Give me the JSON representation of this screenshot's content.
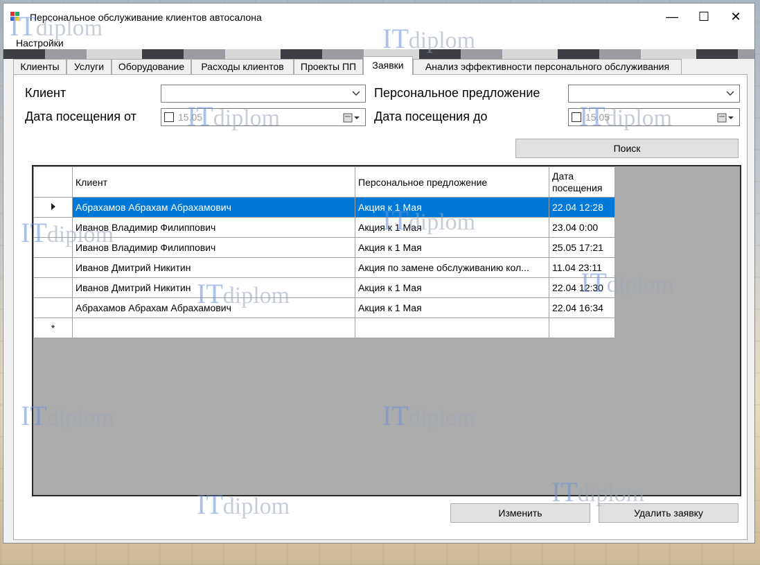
{
  "window": {
    "title": "Персональное обслуживание клиентов автосалона",
    "minimize_glyph": "—",
    "maximize_glyph": "☐",
    "close_glyph": "✕"
  },
  "menu": {
    "settings": "Настройки"
  },
  "tabs": [
    {
      "label": "Клиенты",
      "active": false
    },
    {
      "label": "Услуги",
      "active": false
    },
    {
      "label": "Оборудование",
      "active": false
    },
    {
      "label": "Расходы клиентов",
      "active": false
    },
    {
      "label": "Проекты ПП",
      "active": false
    },
    {
      "label": "Заявки",
      "active": true
    },
    {
      "label": "Анализ эффективности персонального обслуживания",
      "active": false
    }
  ],
  "filters": {
    "client_label": "Клиент",
    "client_value": "",
    "offer_label": "Персональное предложение",
    "offer_value": "",
    "date_from_label": "Дата посещения от",
    "date_from_value": "15.05",
    "date_to_label": "Дата посещения до",
    "date_to_value": "15.05",
    "search_button": "Поиск"
  },
  "grid": {
    "columns": [
      "Клиент",
      "Персональное предложение",
      "Дата\nпосещения"
    ],
    "rows": [
      {
        "client": "Абрахамов Абрахам Абрахамович",
        "offer": "Акция к 1 Мая",
        "date": "22.04 12:28",
        "selected": true
      },
      {
        "client": "Иванов Владимир Филиппович",
        "offer": "Акция к 1 Мая",
        "date": "23.04 0:00",
        "selected": false
      },
      {
        "client": "Иванов Владимир Филиппович",
        "offer": "Акция к 1 Мая",
        "date": "25.05 17:21",
        "selected": false
      },
      {
        "client": "Иванов Дмитрий Никитин",
        "offer": "Акция по замене обслуживанию кол...",
        "date": "11.04 23:11",
        "selected": false
      },
      {
        "client": "Иванов Дмитрий Никитин",
        "offer": "Акция к 1 Мая",
        "date": "22.04 12:30",
        "selected": false
      },
      {
        "client": "Абрахамов Абрахам Абрахамович",
        "offer": "Акция к 1 Мая",
        "date": "22.04 16:34",
        "selected": false
      }
    ],
    "new_row_marker": "*"
  },
  "actions": {
    "edit": "Изменить",
    "delete": "Удалить заявку"
  },
  "watermark": {
    "it": "IT",
    "diplom": "diplom"
  },
  "colors": {
    "selection": "#0078d7",
    "grid_background": "#ababab",
    "watermark_blue": "#6a8fd8"
  }
}
